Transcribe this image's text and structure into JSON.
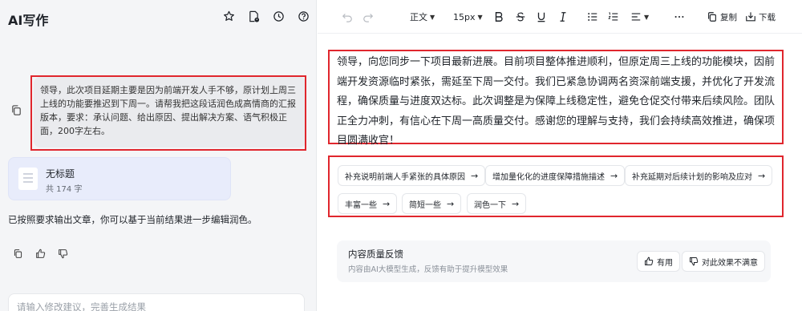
{
  "app": {
    "title": "AI写作"
  },
  "chat": {
    "user_message": "领导，此次项目延期主要是因为前端开发人手不够，原计划上周三上线的功能要推迟到下周一。请帮我把这段话润色成高情商的汇报版本，要求：承认问题、给出原因、提出解决方案、语气积极正面，200字左右。",
    "doc_card": {
      "title": "无标题",
      "count": "共 174 字"
    },
    "reply_text": "已按照要求输出文章，你可以基于当前结果进一步编辑润色。",
    "input_placeholder": "请输入修改建议，完善生成结果"
  },
  "toolbar": {
    "style_label": "正文",
    "size_label": "15px",
    "copy_label": "复制",
    "download_label": "下载"
  },
  "article": {
    "text": "领导，向您同步一下项目最新进展。目前项目整体推进顺利，但原定周三上线的功能模块，因前端开发资源临时紧张，需延至下周一交付。我们已紧急协调两名资深前端支援，并优化了开发流程，确保质量与进度双达标。此次调整是为保障上线稳定性，避免仓促交付带来后续风险。团队正全力冲刺，有信心在下周一高质量交付。感谢您的理解与支持，我们会持续高效推进，确保项目圆满收官！"
  },
  "suggestions": [
    {
      "label": "补充说明前端人手紧张的具体原因"
    },
    {
      "label": "增加量化化的进度保障措施描述"
    },
    {
      "label": "补充延期对后续计划的影响及应对"
    },
    {
      "label": "丰富一些"
    },
    {
      "label": "简短一些"
    },
    {
      "label": "润色一下"
    }
  ],
  "feedback": {
    "title": "内容质量反馈",
    "subtitle": "内容由AI大模型生成，反馈有助于提升模型效果",
    "useful_label": "有用",
    "unsatisfied_label": "对此效果不满意"
  },
  "colors": {
    "highlight_border": "#e0262d",
    "doc_card_bg": "#e8ecfb"
  }
}
